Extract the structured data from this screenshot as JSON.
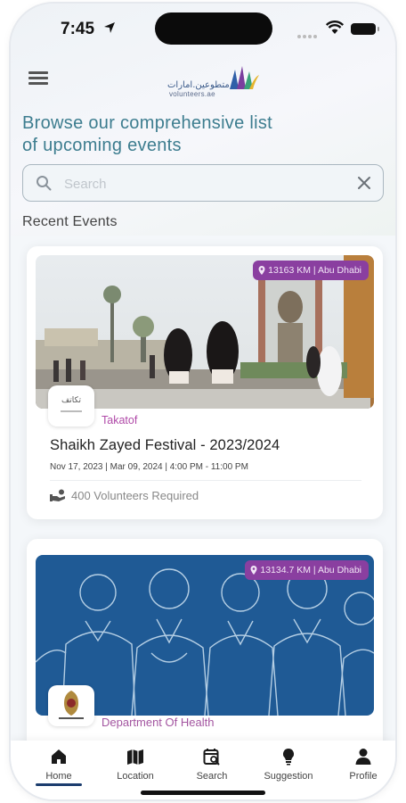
{
  "status_bar": {
    "time": "7:45"
  },
  "header": {
    "logo_ar": "متطوعين.امارات",
    "logo_en": "volunteers.ae",
    "headline_line1": "Browse our comprehensive list",
    "headline_line2": "of upcoming events"
  },
  "search": {
    "placeholder": "Search",
    "value": ""
  },
  "section": {
    "title": "Recent Events"
  },
  "events": [
    {
      "distance": "13163 KM | Abu Dhabi",
      "org_logo_text": "تكاتف",
      "organizer": "Takatof",
      "title": "Shaikh Zayed Festival - 2023/2024",
      "dates": "Nov 17, 2023 | Mar 09, 2024 | 4:00 PM - 11:00 PM",
      "volunteers": "400 Volunteers Required"
    },
    {
      "distance": "13134.7 KM | Abu Dhabi",
      "organizer": "Department Of Health"
    }
  ],
  "tabs": [
    {
      "label": "Home",
      "icon": "home-icon",
      "active": true
    },
    {
      "label": "Location",
      "icon": "map-icon",
      "active": false
    },
    {
      "label": "Search",
      "icon": "calendar-search-icon",
      "active": false
    },
    {
      "label": "Suggestion",
      "icon": "lightbulb-icon",
      "active": false
    },
    {
      "label": "Profile",
      "icon": "person-icon",
      "active": false
    }
  ],
  "colors": {
    "headline": "#3d7d8f",
    "badge": "#8a3fa0",
    "organizer": "#b04aa8",
    "tab_active_underline": "#1c3d6e"
  }
}
